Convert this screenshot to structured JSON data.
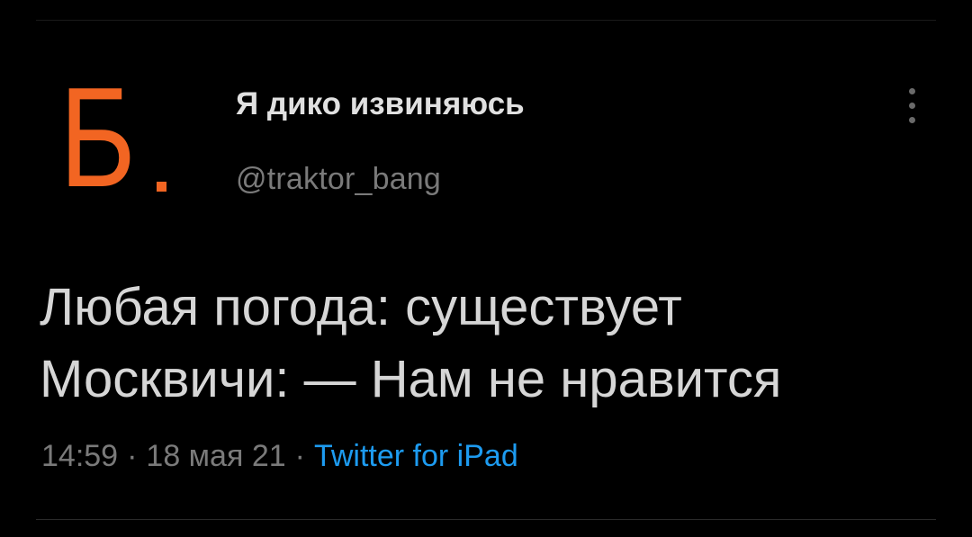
{
  "author": {
    "avatar_letter": "Б",
    "display_name": "Я дико извиняюсь",
    "handle": "@traktor_bang",
    "avatar_color": "#f26522"
  },
  "menu": {
    "icon": "more-vertical-icon"
  },
  "tweet": {
    "lines": [
      "Любая погода: существует",
      "Москвичи: — Нам не нравится"
    ]
  },
  "meta": {
    "time": "14:59",
    "separator": "·",
    "date": "18 мая 21",
    "source": "Twitter for iPad",
    "source_color": "#1d9bf0"
  }
}
